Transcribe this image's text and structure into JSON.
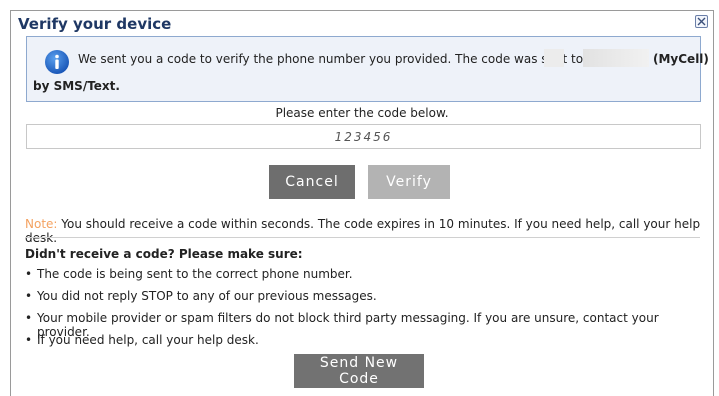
{
  "dialog": {
    "title": "Verify your device",
    "close_icon": "close-icon"
  },
  "info": {
    "icon": "info-icon",
    "line1": "We sent you a code to verify the phone number you provided. The code was sent to",
    "phone_label": "(MyCell)",
    "line2": "by SMS/Text."
  },
  "code": {
    "prompt": "Please enter the code below.",
    "value": "123456"
  },
  "buttons": {
    "cancel": "Cancel",
    "verify": "Verify",
    "send_new_code": "Send New Code"
  },
  "note": {
    "label": "Note:",
    "text": " You should receive a code within seconds. The code expires in 10 minutes. If you need help, call your help desk."
  },
  "help": {
    "title": "Didn't receive a code? Please make sure:",
    "items": [
      "The code is being sent to the correct phone number.",
      "You did not reply STOP to any of our previous messages.",
      "Your mobile provider or spam filters do not block third party messaging. If you are unsure, contact your provider.",
      "If you need help, call your help desk."
    ]
  },
  "colors": {
    "title": "#1f3864",
    "info_bg": "#eef2f9",
    "info_border": "#8ea9cf",
    "note_label": "#f4a261",
    "button_dark": "#6e6e6e",
    "button_disabled": "#b3b3b3"
  }
}
